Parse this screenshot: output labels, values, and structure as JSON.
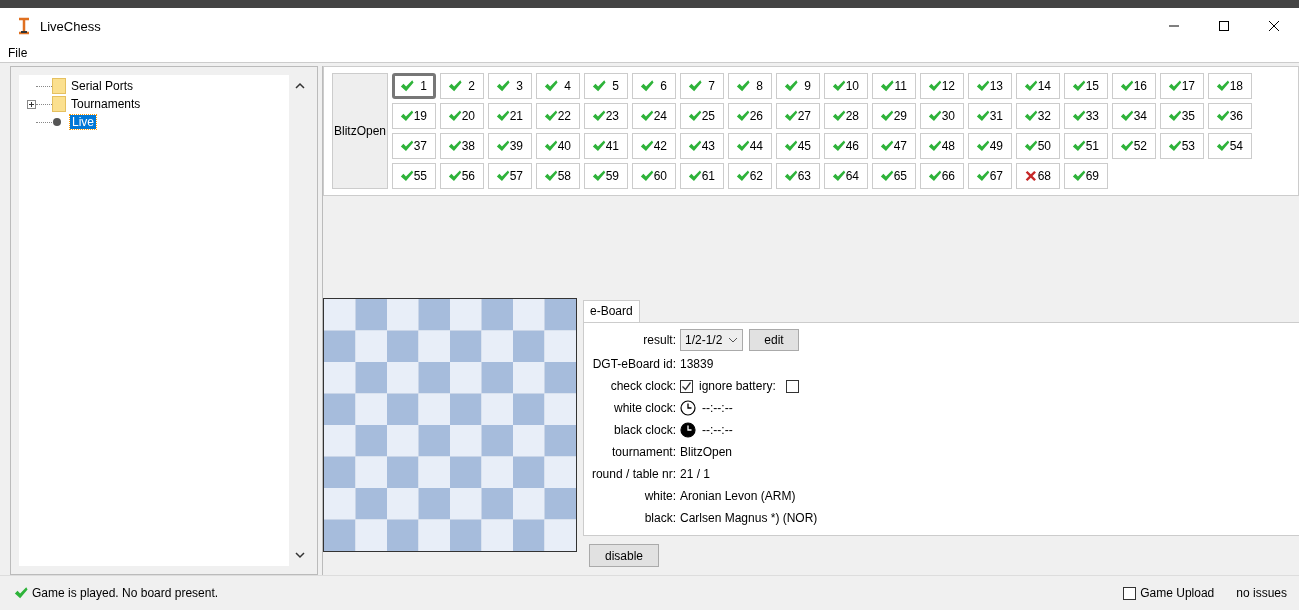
{
  "window": {
    "title": "LiveChess"
  },
  "menu": [
    "File"
  ],
  "tree": [
    {
      "label": "Serial Ports",
      "kind": "folder",
      "selected": false
    },
    {
      "label": "Tournaments",
      "kind": "folder",
      "selected": false,
      "expanded": false
    },
    {
      "label": "Live",
      "kind": "leaf",
      "selected": true
    }
  ],
  "tournament": {
    "name": "BlitzOpen",
    "games": [
      {
        "number": "1",
        "failed": false,
        "selected": true
      },
      {
        "number": "2",
        "failed": false,
        "selected": false
      },
      {
        "number": "3",
        "failed": false,
        "selected": false
      },
      {
        "number": "4",
        "failed": false,
        "selected": false
      },
      {
        "number": "5",
        "failed": false,
        "selected": false
      },
      {
        "number": "6",
        "failed": false,
        "selected": false
      },
      {
        "number": "7",
        "failed": false,
        "selected": false
      },
      {
        "number": "8",
        "failed": false,
        "selected": false
      },
      {
        "number": "9",
        "failed": false,
        "selected": false
      },
      {
        "number": "10",
        "failed": false,
        "selected": false
      },
      {
        "number": "11",
        "failed": false,
        "selected": false
      },
      {
        "number": "12",
        "failed": false,
        "selected": false
      },
      {
        "number": "13",
        "failed": false,
        "selected": false
      },
      {
        "number": "14",
        "failed": false,
        "selected": false
      },
      {
        "number": "15",
        "failed": false,
        "selected": false
      },
      {
        "number": "16",
        "failed": false,
        "selected": false
      },
      {
        "number": "17",
        "failed": false,
        "selected": false
      },
      {
        "number": "18",
        "failed": false,
        "selected": false
      },
      {
        "number": "19",
        "failed": false,
        "selected": false
      },
      {
        "number": "20",
        "failed": false,
        "selected": false
      },
      {
        "number": "21",
        "failed": false,
        "selected": false
      },
      {
        "number": "22",
        "failed": false,
        "selected": false
      },
      {
        "number": "23",
        "failed": false,
        "selected": false
      },
      {
        "number": "24",
        "failed": false,
        "selected": false
      },
      {
        "number": "25",
        "failed": false,
        "selected": false
      },
      {
        "number": "26",
        "failed": false,
        "selected": false
      },
      {
        "number": "27",
        "failed": false,
        "selected": false
      },
      {
        "number": "28",
        "failed": false,
        "selected": false
      },
      {
        "number": "29",
        "failed": false,
        "selected": false
      },
      {
        "number": "30",
        "failed": false,
        "selected": false
      },
      {
        "number": "31",
        "failed": false,
        "selected": false
      },
      {
        "number": "32",
        "failed": false,
        "selected": false
      },
      {
        "number": "33",
        "failed": false,
        "selected": false
      },
      {
        "number": "34",
        "failed": false,
        "selected": false
      },
      {
        "number": "35",
        "failed": false,
        "selected": false
      },
      {
        "number": "36",
        "failed": false,
        "selected": false
      },
      {
        "number": "37",
        "failed": false,
        "selected": false
      },
      {
        "number": "38",
        "failed": false,
        "selected": false
      },
      {
        "number": "39",
        "failed": false,
        "selected": false
      },
      {
        "number": "40",
        "failed": false,
        "selected": false
      },
      {
        "number": "41",
        "failed": false,
        "selected": false
      },
      {
        "number": "42",
        "failed": false,
        "selected": false
      },
      {
        "number": "43",
        "failed": false,
        "selected": false
      },
      {
        "number": "44",
        "failed": false,
        "selected": false
      },
      {
        "number": "45",
        "failed": false,
        "selected": false
      },
      {
        "number": "46",
        "failed": false,
        "selected": false
      },
      {
        "number": "47",
        "failed": false,
        "selected": false
      },
      {
        "number": "48",
        "failed": false,
        "selected": false
      },
      {
        "number": "49",
        "failed": false,
        "selected": false
      },
      {
        "number": "50",
        "failed": false,
        "selected": false
      },
      {
        "number": "51",
        "failed": false,
        "selected": false
      },
      {
        "number": "52",
        "failed": false,
        "selected": false
      },
      {
        "number": "53",
        "failed": false,
        "selected": false
      },
      {
        "number": "54",
        "failed": false,
        "selected": false
      },
      {
        "number": "55",
        "failed": false,
        "selected": false
      },
      {
        "number": "56",
        "failed": false,
        "selected": false
      },
      {
        "number": "57",
        "failed": false,
        "selected": false
      },
      {
        "number": "58",
        "failed": false,
        "selected": false
      },
      {
        "number": "59",
        "failed": false,
        "selected": false
      },
      {
        "number": "60",
        "failed": false,
        "selected": false
      },
      {
        "number": "61",
        "failed": false,
        "selected": false
      },
      {
        "number": "62",
        "failed": false,
        "selected": false
      },
      {
        "number": "63",
        "failed": false,
        "selected": false
      },
      {
        "number": "64",
        "failed": false,
        "selected": false
      },
      {
        "number": "65",
        "failed": false,
        "selected": false
      },
      {
        "number": "66",
        "failed": false,
        "selected": false
      },
      {
        "number": "67",
        "failed": false,
        "selected": false
      },
      {
        "number": "68",
        "failed": true,
        "selected": false
      },
      {
        "number": "69",
        "failed": false,
        "selected": false
      }
    ]
  },
  "eboard": {
    "tab": "e-Board",
    "fields": [
      {
        "kind": "select",
        "label": "result:",
        "value": "1/2-1/2",
        "button": "edit"
      },
      {
        "kind": "text",
        "label": "DGT-eBoard id:",
        "value": "13839"
      },
      {
        "kind": "checks",
        "label": "check clock:",
        "checked": true,
        "extra": {
          "label": "ignore battery:",
          "checked": false
        }
      },
      {
        "kind": "clock",
        "label": "white clock:",
        "dark": false,
        "value": "--:--:--"
      },
      {
        "kind": "clock",
        "label": "black clock:",
        "dark": true,
        "value": "--:--:--"
      },
      {
        "kind": "text",
        "label": "tournament:",
        "value": "BlitzOpen"
      },
      {
        "kind": "text",
        "label": "round / table nr:",
        "value": "21 / 1"
      },
      {
        "kind": "text",
        "label": "white:",
        "value": "Aronian Levon (ARM)"
      },
      {
        "kind": "text",
        "label": "black:",
        "value": "Carlsen Magnus *) (NOR)"
      }
    ],
    "button": "disable"
  },
  "status_bar": {
    "message": "Game is played. No board present.",
    "upload": {
      "label": "Game Upload",
      "checked": false
    },
    "issues": "no issues"
  }
}
